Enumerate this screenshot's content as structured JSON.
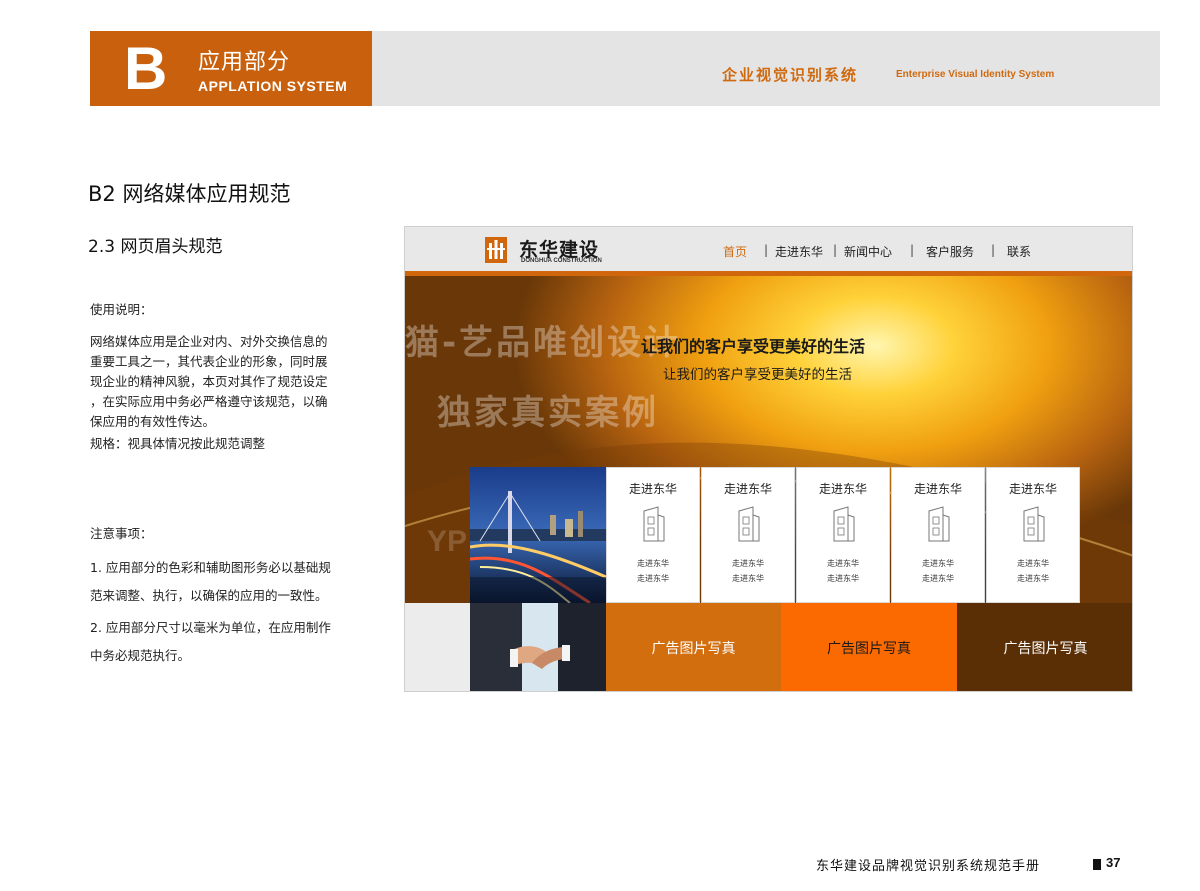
{
  "header": {
    "letter": "B",
    "title_cn": "应用部分",
    "title_en": "APPLATION SYSTEM",
    "vi_cn": "企业视觉识别系统",
    "vi_en": "Enterprise Visual Identity System",
    "accent_color": "#c8600e"
  },
  "section": {
    "title": "B2  网络媒体应用规范",
    "subtitle": "2.3  网页眉头规范"
  },
  "usage": {
    "heading": "使用说明：",
    "lines": [
      "网络媒体应用是企业对内、对外交换信息的",
      "重要工具之一，其代表企业的形象，同时展",
      "现企业的精神风貌，本页对其作了规范设定",
      "，在实际应用中务必严格遵守该规范，以确",
      "保应用的有效性传达。"
    ],
    "spec": "规格：视具体情况按此规范调整"
  },
  "notes": {
    "heading": "注意事项：",
    "n1": [
      "1. 应用部分的色彩和辅助图形务必以基础规",
      "范来调整、执行，以确保的应用的一致性。"
    ],
    "n2": [
      "2. 应用部分尺寸以毫米为单位，在应用制作",
      "中务必规范执行。"
    ]
  },
  "mockup": {
    "logo_cn": "东华建设",
    "logo_en": "DONGHUA CONSTRUCTION",
    "menu": [
      "首页",
      "走进东华",
      "新闻中心",
      "客户服务",
      "联系"
    ],
    "menu_sep": "|",
    "slogan_main": "让我们的客户享受更美好的生活",
    "slogan_sub": "让我们的客户享受更美好的生活",
    "watermark": [
      "猫-艺品唯创设计",
      "独家真实案例",
      "YP"
    ],
    "cards": [
      {
        "title": "走进东华",
        "line1": "走进东华",
        "line2": "走进东华",
        "icon": "building-icon"
      },
      {
        "title": "走进东华",
        "line1": "走进东华",
        "line2": "走进东华",
        "icon": "building-icon"
      },
      {
        "title": "走进东华",
        "line1": "走进东华",
        "line2": "走进东华",
        "icon": "building-icon"
      },
      {
        "title": "走进东华",
        "line1": "走进东华",
        "line2": "走进东华",
        "icon": "building-icon"
      },
      {
        "title": "走进东华",
        "line1": "走进东华",
        "line2": "走进东华",
        "icon": "building-icon"
      }
    ],
    "ads": [
      "广告图片写真",
      "广告图片写真",
      "广告图片写真"
    ],
    "colors": {
      "ad1": "#d26e0e",
      "ad2": "#fa6a00",
      "ad3": "#5a2f06"
    }
  },
  "footer": {
    "text": "东华建设品牌视觉识别系统规范手册",
    "page": "37"
  }
}
